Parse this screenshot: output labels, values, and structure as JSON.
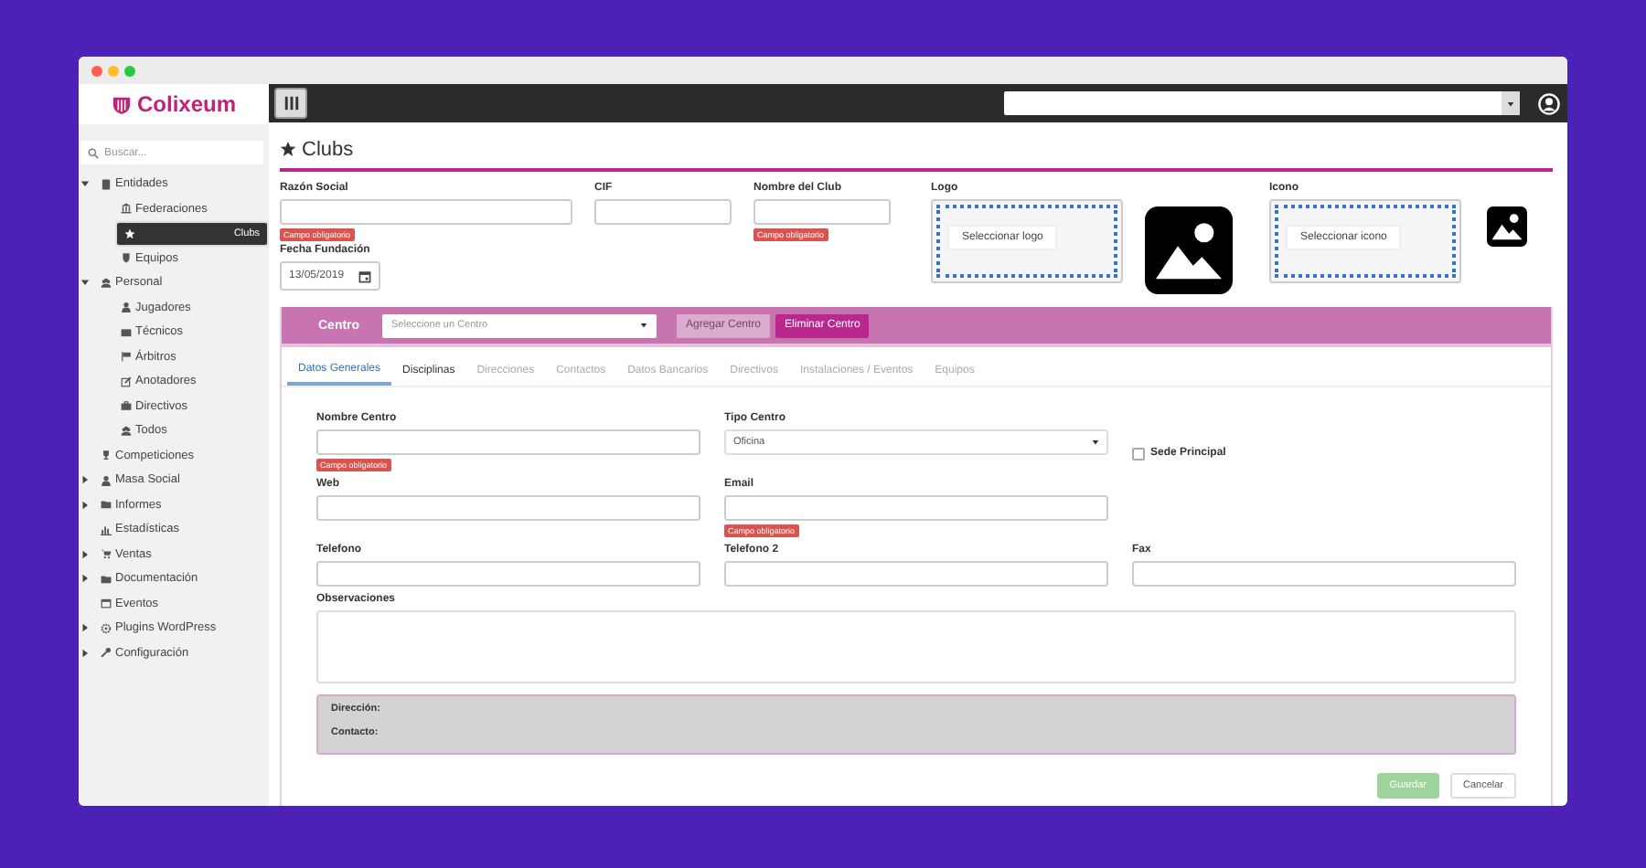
{
  "brand": {
    "name": "Colixeum"
  },
  "sidebar": {
    "search": {
      "placeholder": "Buscar..."
    },
    "items": [
      {
        "label": "Entidades",
        "expanded": true,
        "selected": false,
        "children": [
          {
            "label": "Federaciones",
            "selected": false
          },
          {
            "label": "Clubs",
            "selected": true
          },
          {
            "label": "Equipos",
            "selected": false
          }
        ]
      },
      {
        "label": "Personal",
        "expanded": true,
        "selected": false,
        "children": [
          {
            "label": "Jugadores",
            "selected": false
          },
          {
            "label": "Técnicos",
            "selected": false
          },
          {
            "label": "Árbitros",
            "selected": false
          },
          {
            "label": "Anotadores",
            "selected": false
          },
          {
            "label": "Directivos",
            "selected": false
          },
          {
            "label": "Todos",
            "selected": false
          }
        ]
      },
      {
        "label": "Competiciones",
        "selected": false
      },
      {
        "label": "Masa Social",
        "expanded": false,
        "selected": false
      },
      {
        "label": "Informes",
        "expanded": false,
        "selected": false
      },
      {
        "label": "Estadísticas",
        "selected": false
      },
      {
        "label": "Ventas",
        "expanded": false,
        "selected": false
      },
      {
        "label": "Documentación",
        "expanded": false,
        "selected": false
      },
      {
        "label": "Eventos",
        "selected": false
      },
      {
        "label": "Plugins WordPress",
        "expanded": false,
        "selected": false
      },
      {
        "label": "Configuración",
        "expanded": false,
        "selected": false
      }
    ]
  },
  "page": {
    "title": "Clubs"
  },
  "club_form": {
    "fields": [
      {
        "label": "Razón Social",
        "kind": "text",
        "error": "Campo obligatorio"
      },
      {
        "label": "CIF",
        "kind": "text"
      },
      {
        "label": "Nombre del Club",
        "kind": "text",
        "error": "Campo obligatorio"
      }
    ],
    "date": {
      "label": "Fecha Fundación",
      "value": "13/05/2019"
    },
    "images": [
      {
        "label": "Logo",
        "button": "Seleccionar logo"
      },
      {
        "label": "Icono",
        "button": "Seleccionar icono"
      }
    ]
  },
  "centro": {
    "label": "Centro",
    "select": {
      "placeholder": "Seleccione un Centro"
    },
    "buttons": [
      {
        "label": "Agregar Centro",
        "kind": "secondary"
      },
      {
        "label": "Eliminar Centro",
        "kind": "danger"
      }
    ],
    "tabs": [
      {
        "label": "Datos Generales",
        "selected": true,
        "disabled": false
      },
      {
        "label": "Disciplinas",
        "selected": false,
        "disabled": false
      },
      {
        "label": "Direcciones",
        "selected": false,
        "disabled": true
      },
      {
        "label": "Contactos",
        "selected": false,
        "disabled": true
      },
      {
        "label": "Datos Bancarios",
        "selected": false,
        "disabled": true
      },
      {
        "label": "Directivos",
        "selected": false,
        "disabled": true
      },
      {
        "label": "Instalaciones / Eventos",
        "selected": false,
        "disabled": true
      },
      {
        "label": "Equipos",
        "selected": false,
        "disabled": true
      }
    ],
    "fields": [
      {
        "label": "Nombre Centro",
        "kind": "text",
        "error": "Campo obligatorio"
      },
      {
        "label": "Tipo Centro",
        "kind": "select",
        "value": "Oficina"
      },
      {
        "label": "Sede Principal",
        "kind": "checkbox",
        "checked": false
      },
      {
        "label": "Web",
        "kind": "text"
      },
      {
        "label": "Email",
        "kind": "text",
        "error": "Campo obligatorio"
      },
      {
        "kind": "empty"
      },
      {
        "label": "Telefono",
        "kind": "text"
      },
      {
        "label": "Telefono 2",
        "kind": "text"
      },
      {
        "label": "Fax",
        "kind": "text"
      },
      {
        "label": "Observaciones",
        "kind": "textarea"
      }
    ],
    "summary": [
      "Dirección:",
      "Contacto:"
    ],
    "actions": [
      {
        "label": "Guardar",
        "kind": "primary",
        "disabled": true
      },
      {
        "label": "Cancelar",
        "kind": "default",
        "disabled": false
      }
    ]
  }
}
